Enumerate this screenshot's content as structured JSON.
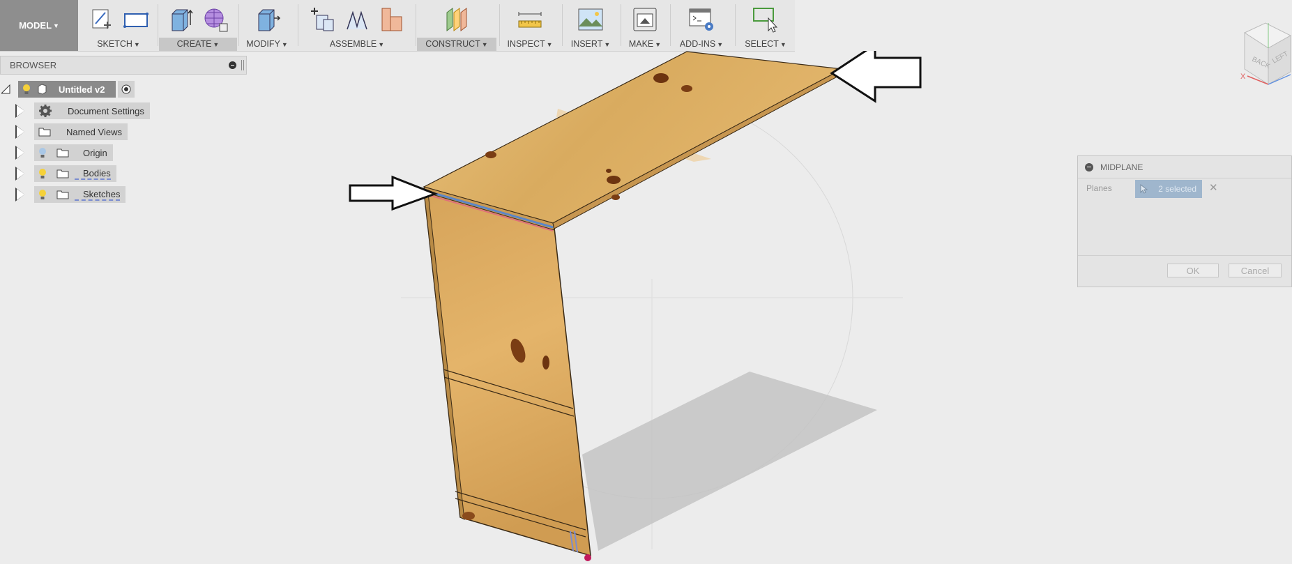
{
  "toolbar": {
    "mode": "MODEL",
    "groups": [
      {
        "label": "SKETCH"
      },
      {
        "label": "CREATE"
      },
      {
        "label": "MODIFY"
      },
      {
        "label": "ASSEMBLE"
      },
      {
        "label": "CONSTRUCT"
      },
      {
        "label": "INSPECT"
      },
      {
        "label": "INSERT"
      },
      {
        "label": "MAKE"
      },
      {
        "label": "ADD-INS"
      },
      {
        "label": "SELECT"
      }
    ]
  },
  "browser": {
    "title": "BROWSER",
    "root": "Untitled v2",
    "items": [
      {
        "label": "Document Settings",
        "icon": "gear-icon"
      },
      {
        "label": "Named Views",
        "icon": "folder-icon"
      },
      {
        "label": "Origin",
        "icon": "folder-icon"
      },
      {
        "label": "Bodies",
        "icon": "folder-icon"
      },
      {
        "label": "Sketches",
        "icon": "folder-icon"
      }
    ]
  },
  "viewcube": {
    "back": "BACK",
    "left": "LEFT",
    "axis_x": "X"
  },
  "dialog": {
    "title": "MIDPLANE",
    "planes_label": "Planes",
    "selection": "2 selected",
    "ok": "OK",
    "cancel": "Cancel"
  },
  "colors": {
    "toolbar_bg": "#e6e6e6",
    "model_button": "#8e8e8e",
    "wood": "#d8a85a",
    "selection_blue": "#9fb6cd"
  }
}
